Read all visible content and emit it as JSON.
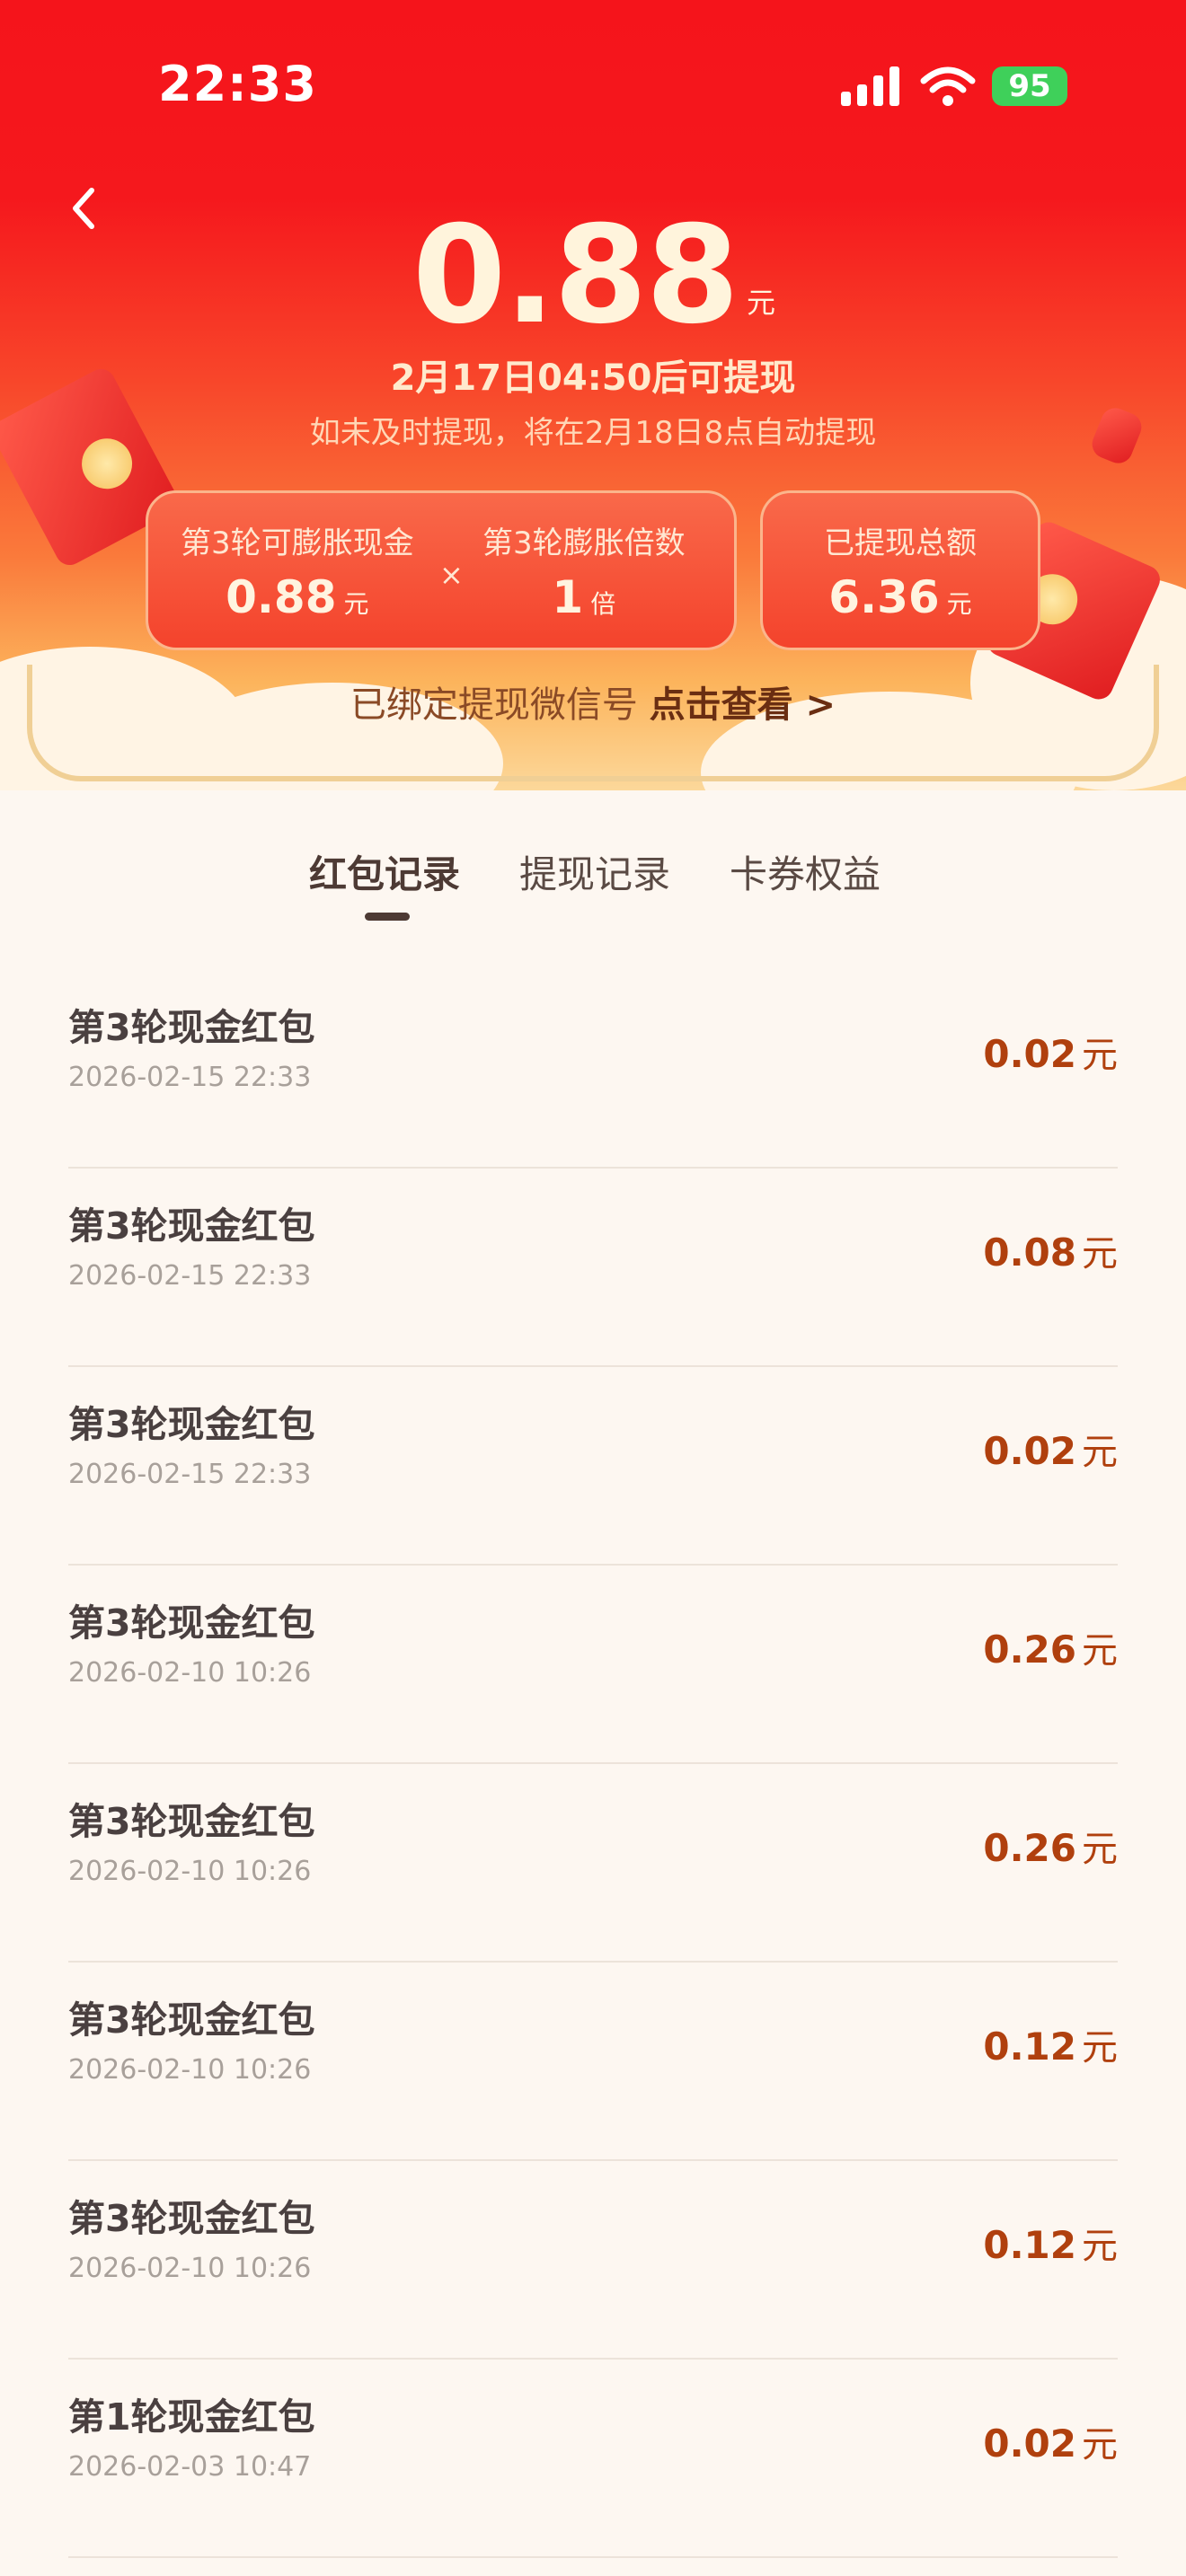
{
  "status_bar": {
    "time": "22:33",
    "battery": "95"
  },
  "header": {
    "balance": "0.88",
    "balance_unit": "元",
    "withdraw_time": "2月17日04:50后可提现",
    "auto_note": "如未及时提现，将在2月18日8点自动提现"
  },
  "card": {
    "cash_label": "第3轮可膨胀现金",
    "cash_value": "0.88",
    "cash_unit": "元",
    "times_symbol": "×",
    "multiplier_label": "第3轮膨胀倍数",
    "multiplier_value": "1",
    "multiplier_unit": "倍",
    "total_label": "已提现总额",
    "total_value": "6.36",
    "total_unit": "元"
  },
  "bind": {
    "text": "已绑定提现微信号",
    "link": "点击查看 >"
  },
  "tabs": [
    {
      "label": "红包记录",
      "active": true
    },
    {
      "label": "提现记录",
      "active": false
    },
    {
      "label": "卡券权益",
      "active": false
    }
  ],
  "records": [
    {
      "title": "第3轮现金红包",
      "time": "2026-02-15 22:33",
      "amount": "0.02",
      "unit": "元"
    },
    {
      "title": "第3轮现金红包",
      "time": "2026-02-15 22:33",
      "amount": "0.08",
      "unit": "元"
    },
    {
      "title": "第3轮现金红包",
      "time": "2026-02-15 22:33",
      "amount": "0.02",
      "unit": "元"
    },
    {
      "title": "第3轮现金红包",
      "time": "2026-02-10 10:26",
      "amount": "0.26",
      "unit": "元"
    },
    {
      "title": "第3轮现金红包",
      "time": "2026-02-10 10:26",
      "amount": "0.26",
      "unit": "元"
    },
    {
      "title": "第3轮现金红包",
      "time": "2026-02-10 10:26",
      "amount": "0.12",
      "unit": "元"
    },
    {
      "title": "第3轮现金红包",
      "time": "2026-02-10 10:26",
      "amount": "0.12",
      "unit": "元"
    },
    {
      "title": "第1轮现金红包",
      "time": "2026-02-03 10:47",
      "amount": "0.02",
      "unit": "元"
    }
  ],
  "icons": {
    "back": "chevron-left-icon",
    "signal": "cellular-signal-icon",
    "wifi": "wifi-icon",
    "battery": "battery-icon"
  },
  "colors": {
    "hero_red": "#f5141b",
    "amount": "#b0400e",
    "accent_gold": "#f0cf95"
  }
}
